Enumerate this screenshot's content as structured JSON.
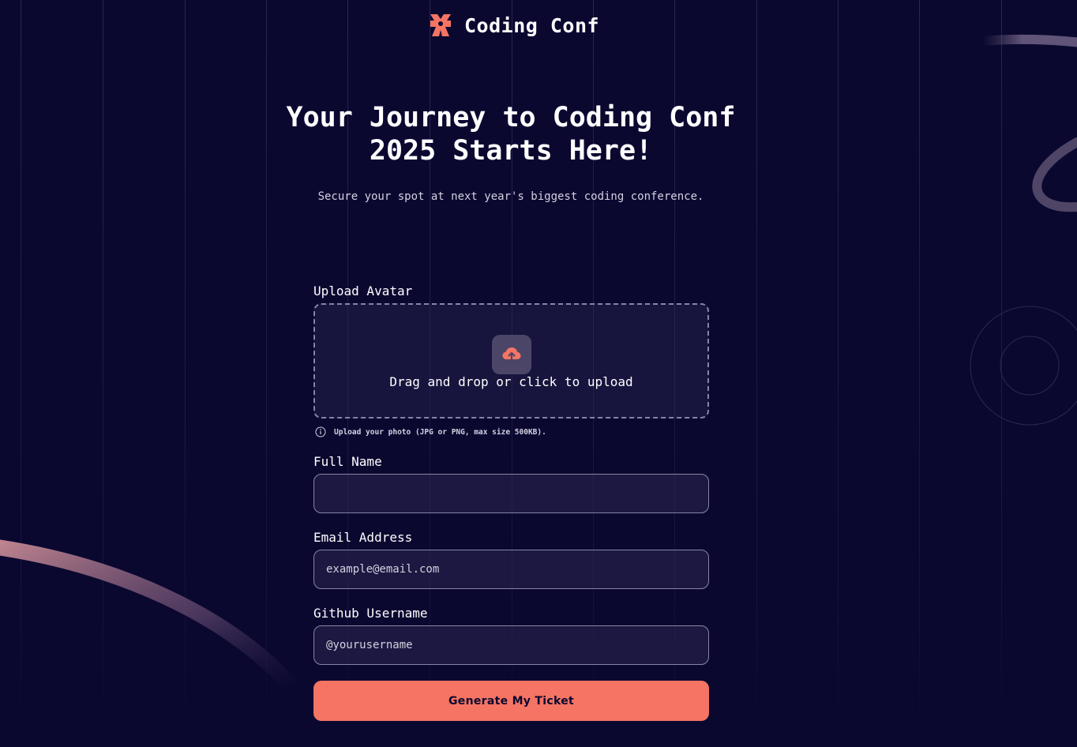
{
  "brand": {
    "name": "Coding Conf",
    "logo_icon": "coding-conf-logo-icon"
  },
  "hero": {
    "title_line1": "Your Journey to Coding Conf",
    "title_line2": "2025 Starts Here!",
    "subtitle": "Secure your spot at next year's biggest coding conference."
  },
  "form": {
    "avatar": {
      "label": "Upload Avatar",
      "dropzone_text": "Drag and drop or click to upload",
      "upload_icon": "cloud-upload-icon",
      "hint_icon": "info-icon",
      "hint": "Upload your photo (JPG or PNG, max size 500KB)."
    },
    "full_name": {
      "label": "Full Name",
      "value": "",
      "placeholder": ""
    },
    "email": {
      "label": "Email Address",
      "value": "",
      "placeholder": "example@email.com"
    },
    "github": {
      "label": "Github Username",
      "value": "",
      "placeholder": "@yourusername"
    },
    "submit_label": "Generate My Ticket"
  },
  "colors": {
    "background": "#0b0830",
    "accent": "#f57463",
    "text": "#ffffff",
    "muted_text": "#d2d1e0",
    "border": "#8784a5"
  }
}
